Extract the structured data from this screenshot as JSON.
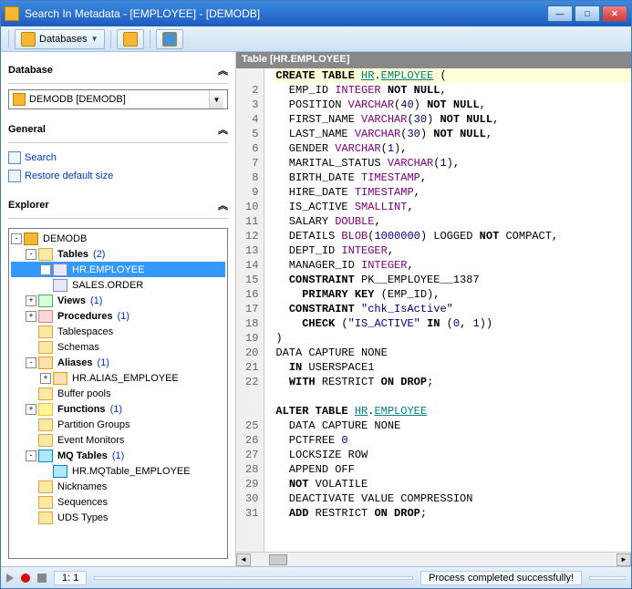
{
  "title": "Search In Metadata - [EMPLOYEE] - [DEMODB]",
  "toolbar": {
    "databases_label": "Databases"
  },
  "left": {
    "database_hdr": "Database",
    "combo_value": "DEMODB [DEMODB]",
    "general_hdr": "General",
    "search_label": "Search",
    "restore_label": "Restore default size",
    "explorer_hdr": "Explorer",
    "tree": {
      "root": "DEMODB",
      "tables": {
        "label": "Tables",
        "count": "(2)",
        "items": [
          "HR.EMPLOYEE",
          "SALES.ORDER"
        ]
      },
      "views": {
        "label": "Views",
        "count": "(1)"
      },
      "procedures": {
        "label": "Procedures",
        "count": "(1)"
      },
      "tablespaces": "Tablespaces",
      "schemas": "Schemas",
      "aliases": {
        "label": "Aliases",
        "count": "(1)",
        "items": [
          "HR.ALIAS_EMPLOYEE"
        ]
      },
      "buffer": "Buffer pools",
      "functions": {
        "label": "Functions",
        "count": "(1)"
      },
      "partition": "Partition Groups",
      "events": "Event Monitors",
      "mq": {
        "label": "MQ Tables",
        "count": "(1)",
        "items": [
          "HR.MQTable_EMPLOYEE"
        ]
      },
      "nicknames": "Nicknames",
      "sequences": "Sequences",
      "uds": "UDS Types"
    }
  },
  "code": {
    "header": "Table [HR.EMPLOYEE]",
    "lines": [
      {
        "n": "",
        "h": "<span class='kw'>CREATE TABLE</span> <span class='id'>HR</span>.<span class='id'>EMPLOYEE</span> (",
        "cls": "line1"
      },
      {
        "n": "2",
        "h": "  EMP_ID <span class='tk'>INTEGER</span> <span class='kw'>NOT NULL</span>,"
      },
      {
        "n": "3",
        "h": "  POSITION <span class='tk'>VARCHAR</span>(<span class='nm'>40</span>) <span class='kw'>NOT NULL</span>,"
      },
      {
        "n": "4",
        "h": "  FIRST_NAME <span class='tk'>VARCHAR</span>(<span class='nm'>30</span>) <span class='kw'>NOT NULL</span>,"
      },
      {
        "n": "5",
        "h": "  LAST_NAME <span class='tk'>VARCHAR</span>(<span class='nm'>30</span>) <span class='kw'>NOT NULL</span>,"
      },
      {
        "n": "6",
        "h": "  GENDER <span class='tk'>VARCHAR</span>(<span class='nm'>1</span>),"
      },
      {
        "n": "7",
        "h": "  MARITAL_STATUS <span class='tk'>VARCHAR</span>(<span class='nm'>1</span>),"
      },
      {
        "n": "8",
        "h": "  BIRTH_DATE <span class='tk'>TIMESTAMP</span>,"
      },
      {
        "n": "9",
        "h": "  HIRE_DATE <span class='tk'>TIMESTAMP</span>,"
      },
      {
        "n": "10",
        "h": "  IS_ACTIVE <span class='tk'>SMALLINT</span>,"
      },
      {
        "n": "11",
        "h": "  SALARY <span class='tk'>DOUBLE</span>,"
      },
      {
        "n": "12",
        "h": "  DETAILS <span class='tk'>BLOB</span>(<span class='nm'>1000000</span>) LOGGED <span class='kw'>NOT</span> COMPACT,"
      },
      {
        "n": "13",
        "h": "  DEPT_ID <span class='tk'>INTEGER</span>,"
      },
      {
        "n": "14",
        "h": "  MANAGER_ID <span class='tk'>INTEGER</span>,"
      },
      {
        "n": "15",
        "h": "  <span class='kw'>CONSTRAINT</span> PK__EMPLOYEE__1387"
      },
      {
        "n": "16",
        "h": "    <span class='kw'>PRIMARY KEY</span> (EMP_ID),"
      },
      {
        "n": "17",
        "h": "  <span class='kw'>CONSTRAINT</span> <span class='st'>\"chk_IsActive\"</span>"
      },
      {
        "n": "18",
        "h": "    <span class='kw'>CHECK</span> (<span class='st'>\"IS_ACTIVE\"</span> <span class='kw'>IN</span> (<span class='nm'>0</span>, <span class='nm'>1</span>))"
      },
      {
        "n": "19",
        "h": ")"
      },
      {
        "n": "20",
        "h": "DATA CAPTURE NONE"
      },
      {
        "n": "21",
        "h": "  <span class='kw'>IN</span> USERSPACE1"
      },
      {
        "n": "22",
        "h": "  <span class='kw'>WITH</span> RESTRICT <span class='kw'>ON DROP</span>;"
      },
      {
        "n": "",
        "h": ""
      },
      {
        "n": "",
        "h": "<span class='kw'>ALTER TABLE</span> <span class='id'>HR</span>.<span class='id'>EMPLOYEE</span>"
      },
      {
        "n": "25",
        "h": "  DATA CAPTURE NONE"
      },
      {
        "n": "26",
        "h": "  PCTFREE <span class='nm'>0</span>"
      },
      {
        "n": "27",
        "h": "  LOCKSIZE ROW"
      },
      {
        "n": "28",
        "h": "  APPEND OFF"
      },
      {
        "n": "29",
        "h": "  <span class='kw'>NOT</span> VOLATILE"
      },
      {
        "n": "30",
        "h": "  DEACTIVATE VALUE COMPRESSION"
      },
      {
        "n": "31",
        "h": "  <span class='kw'>ADD</span> RESTRICT <span class='kw'>ON DROP</span>;"
      }
    ]
  },
  "status": {
    "pos": "1:   1",
    "msg": "Process completed successfully!"
  }
}
